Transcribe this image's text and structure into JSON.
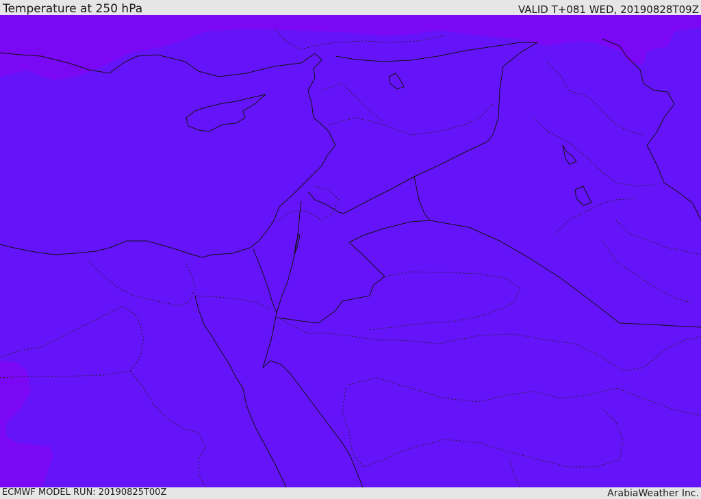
{
  "header": {
    "title": "Temperature at 250 hPa",
    "valid": "VALID T+081 WED, 20190828T09Z"
  },
  "footer": {
    "model_run": "ECMWF MODEL RUN: 20190825T00Z",
    "credit": "ArabiaWeather Inc."
  },
  "colors": {
    "field_main": "#6514fa",
    "field_warm": "#7a08f5",
    "bar_background": "#e6e6e6",
    "lines": "#111111"
  }
}
